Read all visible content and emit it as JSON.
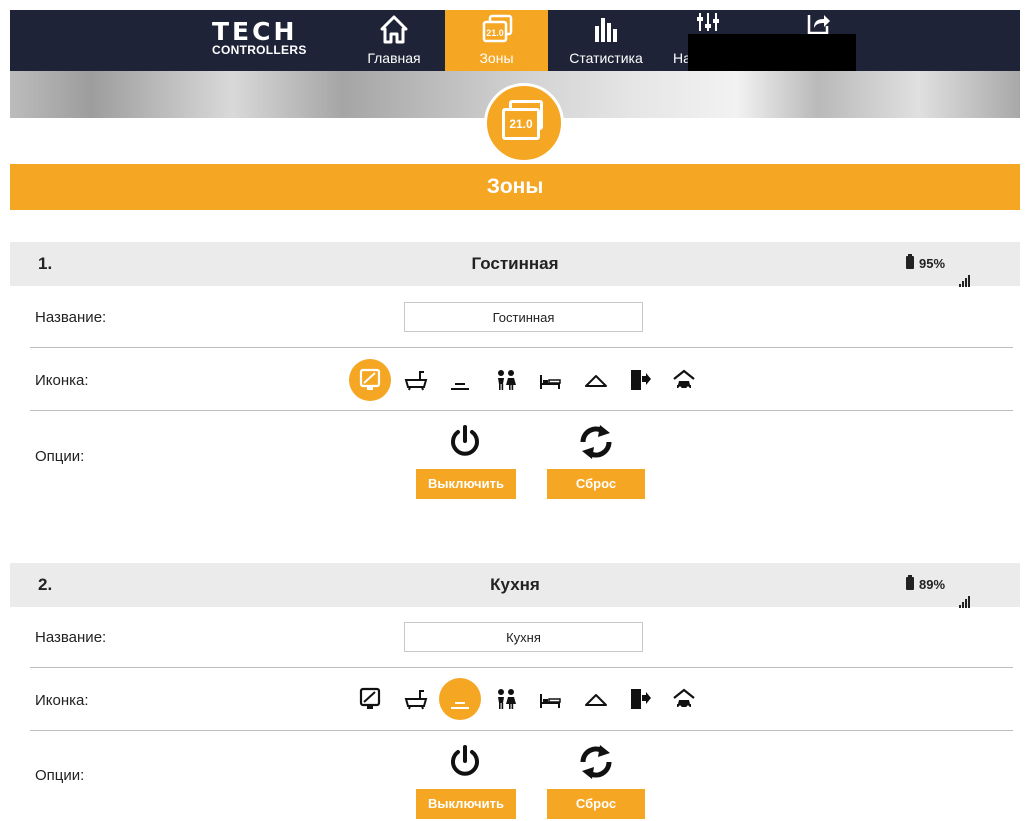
{
  "nav": {
    "logo_mark": "TECH",
    "logo_sub": "CONTROLLERS",
    "items": [
      {
        "label": "Главная",
        "icon": "home-icon"
      },
      {
        "label": "Зоны",
        "icon": "zones-icon",
        "icon_text": "21.0",
        "active": true
      },
      {
        "label": "Статистика",
        "icon": "statistics-icon"
      },
      {
        "label": "На",
        "icon": "settings-sliders-icon"
      },
      {
        "label": "",
        "icon": "share-icon"
      }
    ]
  },
  "badge": {
    "value": "21.0"
  },
  "section_title": "Зоны",
  "accent_color": "#f5a623",
  "nav_color": "#1f2337",
  "zones": [
    {
      "number": "1.",
      "name": "Гостинная",
      "battery": "95%",
      "name_label": "Название:",
      "name_value": "Гостинная",
      "icon_label": "Иконка:",
      "selected_icon": "living-room-tv-icon",
      "options_label": "Опции:",
      "off_button": "Выключить",
      "reset_button": "Сброс"
    },
    {
      "number": "2.",
      "name": "Кухня",
      "battery": "89%",
      "name_label": "Название:",
      "name_value": "Кухня",
      "icon_label": "Иконка:",
      "selected_icon": "kitchen-chef-hat-icon",
      "options_label": "Опции:",
      "off_button": "Выключить",
      "reset_button": "Сброс"
    }
  ],
  "zone_icons": [
    "living-room-tv-icon",
    "bathroom-icon",
    "kitchen-chef-hat-icon",
    "kids-room-icon",
    "bedroom-icon",
    "wardrobe-hanger-icon",
    "exit-door-icon",
    "garage-icon"
  ]
}
